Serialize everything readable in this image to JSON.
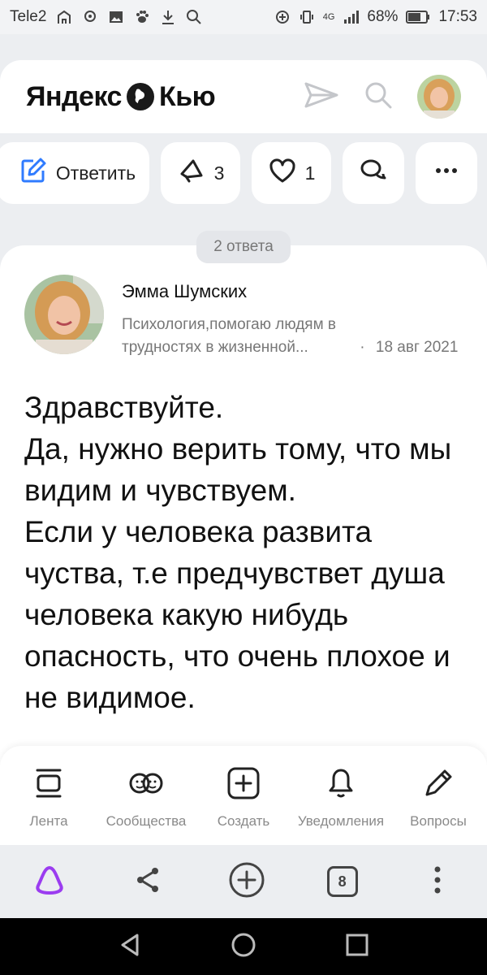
{
  "status_bar": {
    "carrier": "Tele2",
    "network": "4G",
    "battery": "68%",
    "time": "17:53"
  },
  "header": {
    "logo_text_left": "Яндекс",
    "logo_text_right": "Кью"
  },
  "actions": {
    "reply_label": "Ответить",
    "upvote_count": "3",
    "like_count": "1"
  },
  "answers_count_label": "2 ответа",
  "answer": {
    "author_name": "Эмма Шумских",
    "author_description": "Психология,помогаю людям в трудностях в жизненной...",
    "separator": "·",
    "date": "18 авг 2021",
    "text": "Здравствуйте.\nДа, нужно верить тому, что мы видим и чувствуем.\nЕсли у человека развита чуства, т.е предчувствет душа человека какую нибудь опасность, что очень плохое и не видимое."
  },
  "bottom_nav": {
    "items": [
      {
        "label": "Лента",
        "icon": "feed-icon"
      },
      {
        "label": "Сообщества",
        "icon": "communities-icon"
      },
      {
        "label": "Создать",
        "icon": "create-icon"
      },
      {
        "label": "Уведомления",
        "icon": "bell-icon"
      },
      {
        "label": "Вопросы",
        "icon": "pencil-icon"
      }
    ]
  },
  "browser_bar": {
    "tabs_count": "8"
  },
  "colors": {
    "accent_blue": "#2f7bff",
    "alice_purple": "#9b3cf0"
  }
}
